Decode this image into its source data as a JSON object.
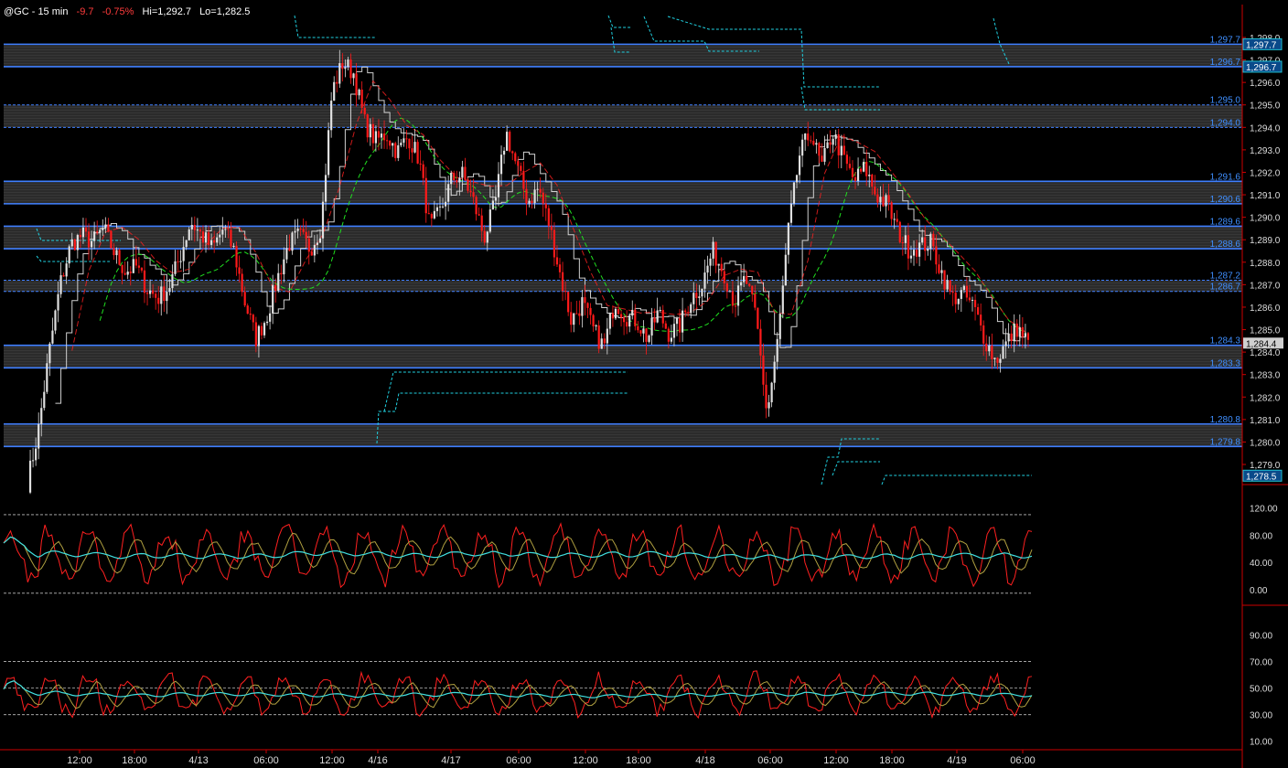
{
  "header": {
    "symbol": "@GC - 15 min",
    "change": "-9.7",
    "change_pct": "-0.75%",
    "hi": "Hi=1,292.7",
    "lo": "Lo=1,282.5"
  },
  "colors": {
    "background": "#000000",
    "axis": "#cc0000",
    "level_line": "#3f7fff",
    "level_label": "#3f8fff",
    "band": "#3a3a3a",
    "candle_up": "#e0e0e0",
    "candle_down": "#ff1a1a",
    "ma_white": "#d0d0d0",
    "ma_green": "#20e020",
    "ma_red": "#ff2020",
    "cyan": "#20d0e0",
    "osc_red": "#ff2020",
    "osc_olive": "#b0a040",
    "osc_cyan": "#40e0e0",
    "current_price_box": "#d0d0d0"
  },
  "chart_data": [
    {
      "type": "candlestick",
      "title": "",
      "x_tick_labels": [
        "12:00",
        "18:00",
        "4/13",
        "06:00",
        "12:00",
        "4/16",
        "4/17",
        "06:00",
        "12:00",
        "18:00",
        "4/18",
        "06:00",
        "12:00",
        "18:00",
        "4/19",
        "06:00"
      ],
      "ylim": [
        1278.0,
        1298.3
      ],
      "y_tick_labels": [
        "1,298.0",
        "1,297.0",
        "1,296.0",
        "1,295.0",
        "1,294.0",
        "1,293.0",
        "1,292.0",
        "1,291.0",
        "1,290.0",
        "1,289.0",
        "1,288.0",
        "1,287.0",
        "1,286.0",
        "1,285.0",
        "1,284.0",
        "1,283.0",
        "1,282.0",
        "1,281.0",
        "1,280.0",
        "1,279.0"
      ],
      "current_price": "1,284.4",
      "axis_boxes": [
        "1,297.7",
        "1,296.7",
        "1,278.5"
      ],
      "levels": [
        {
          "value": 1297.7,
          "label": "1,297.7",
          "style": "solid"
        },
        {
          "value": 1296.7,
          "label": "1,296.7",
          "style": "solid"
        },
        {
          "value": 1295.0,
          "label": "1,295.0",
          "style": "dashed"
        },
        {
          "value": 1294.0,
          "label": "1,294.0",
          "style": "dashed"
        },
        {
          "value": 1291.6,
          "label": "1,291.6",
          "style": "solid"
        },
        {
          "value": 1290.6,
          "label": "1,290.6",
          "style": "solid"
        },
        {
          "value": 1289.6,
          "label": "1,289.6",
          "style": "solid"
        },
        {
          "value": 1288.6,
          "label": "1,288.6",
          "style": "solid"
        },
        {
          "value": 1287.2,
          "label": "1,287.2",
          "style": "dashed"
        },
        {
          "value": 1286.7,
          "label": "1,286.7",
          "style": "dashed"
        },
        {
          "value": 1284.3,
          "label": "1,284.3",
          "style": "solid"
        },
        {
          "value": 1283.3,
          "label": "1,283.3",
          "style": "solid"
        },
        {
          "value": 1280.8,
          "label": "1,280.8",
          "style": "solid"
        },
        {
          "value": 1279.8,
          "label": "1,279.8",
          "style": "solid"
        }
      ],
      "price_path": [
        1278.2,
        1280.5,
        1284.0,
        1287.0,
        1288.8,
        1289.2,
        1288.9,
        1289.5,
        1288.4,
        1287.6,
        1287.8,
        1286.8,
        1286.4,
        1286.9,
        1288.2,
        1289.8,
        1289.2,
        1288.6,
        1289.5,
        1288.5,
        1286.2,
        1284.6,
        1285.6,
        1287.3,
        1288.8,
        1289.2,
        1288.6,
        1289.6,
        1295.6,
        1296.9,
        1296.4,
        1294.2,
        1293.4,
        1293.7,
        1292.9,
        1293.6,
        1292.6,
        1289.5,
        1290.3,
        1291.7,
        1291.9,
        1290.7,
        1289.1,
        1290.6,
        1293.8,
        1292.2,
        1290.7,
        1291.3,
        1289.6,
        1287.4,
        1285.4,
        1286.2,
        1285.0,
        1284.2,
        1286.3,
        1285.6,
        1285.4,
        1284.6,
        1285.8,
        1284.8,
        1285.2,
        1286.4,
        1287.0,
        1288.5,
        1287.6,
        1286.2,
        1287.3,
        1285.5,
        1281.2,
        1284.6,
        1289.6,
        1292.8,
        1293.8,
        1292.2,
        1293.8,
        1292.6,
        1291.6,
        1292.2,
        1291.0,
        1290.6,
        1289.4,
        1288.6,
        1288.7,
        1288.9,
        1287.6,
        1286.4,
        1286.6,
        1286.0,
        1284.6,
        1283.6,
        1284.4,
        1285.1,
        1284.4
      ]
    },
    {
      "type": "line",
      "title": "",
      "y_tick_labels": [
        "120.00",
        "80.00",
        "40.00",
        "0.00"
      ],
      "ylim": [
        -20,
        130
      ],
      "reference_lines": [
        110,
        -5
      ],
      "series_colors": [
        "osc_red",
        "osc_olive",
        "osc_cyan"
      ]
    },
    {
      "type": "line",
      "title": "",
      "y_tick_labels": [
        "90.00",
        "70.00",
        "50.00",
        "30.00",
        "10.00"
      ],
      "ylim": [
        5,
        100
      ],
      "reference_lines": [
        70,
        50,
        30
      ],
      "series_colors": [
        "osc_red",
        "osc_olive",
        "osc_cyan"
      ]
    }
  ]
}
